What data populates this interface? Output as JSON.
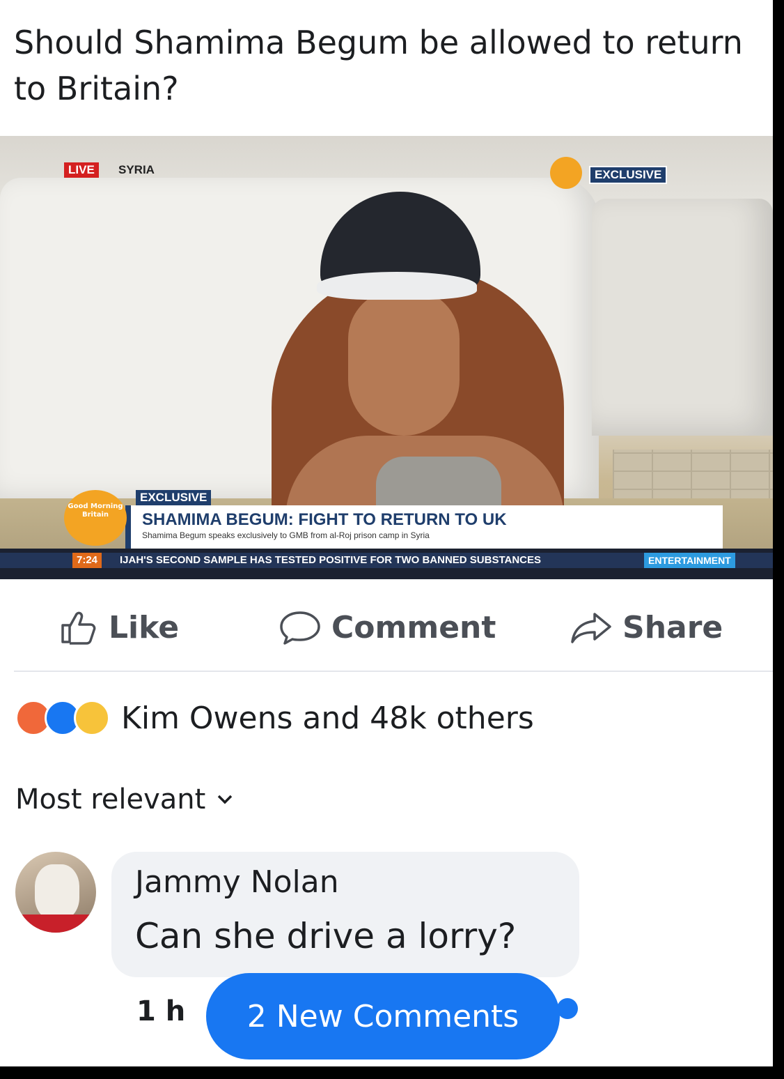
{
  "post": {
    "title": "Should Shamima Begum be allowed to return to Britain?"
  },
  "video": {
    "live_label": "LIVE",
    "location_label": "SYRIA",
    "exclusive_top": "EXCLUSIVE",
    "exclusive_lower": "EXCLUSIVE",
    "channel_logo_text": "Good Morning Britain",
    "headline": "SHAMIMA BEGUM: FIGHT TO RETURN TO UK",
    "subheadline": "Shamima Begum speaks exclusively to GMB from al-Roj prison camp in Syria",
    "ticker_time": "7:24",
    "ticker_text": "IJAH'S SECOND SAMPLE HAS TESTED POSITIVE FOR TWO BANNED SUBSTANCES",
    "ticker_category": "ENTERTAINMENT"
  },
  "actions": {
    "like": "Like",
    "comment": "Comment",
    "share": "Share"
  },
  "reactions": {
    "icons": [
      "angry-reaction",
      "like-reaction",
      "haha-reaction"
    ],
    "summary": "Kim Owens and 48k others"
  },
  "comments": {
    "sort_label": "Most relevant",
    "items": [
      {
        "author": "Jammy Nolan",
        "text": "Can she drive a lorry?",
        "time": "1 h"
      }
    ],
    "new_comments_label": "2 New Comments"
  },
  "colors": {
    "accent": "#1877f2",
    "text": "#1c1e21",
    "muted": "#4b4f56",
    "bubble": "#f0f2f5"
  }
}
